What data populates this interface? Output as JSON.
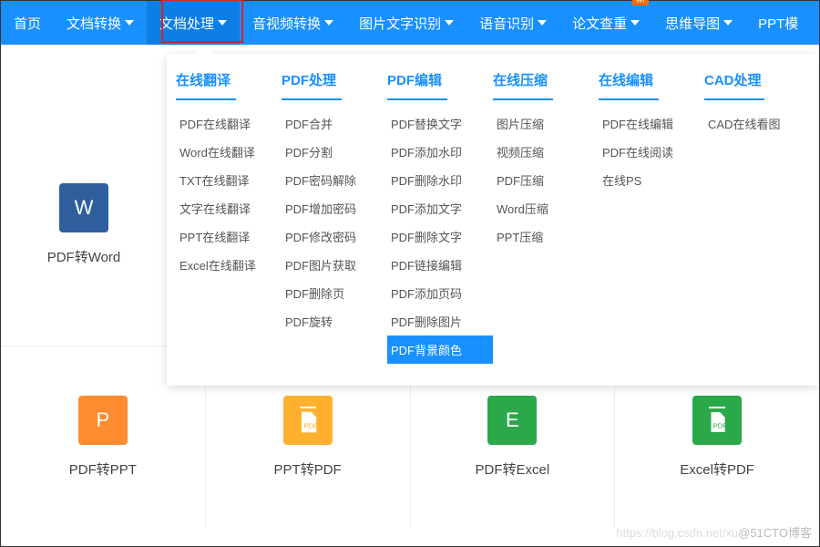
{
  "nav": {
    "items": [
      {
        "label": "首页",
        "caret": false
      },
      {
        "label": "文档转换",
        "caret": true
      },
      {
        "label": "文档处理",
        "caret": true
      },
      {
        "label": "音视频转换",
        "caret": true
      },
      {
        "label": "图片文字识别",
        "caret": true
      },
      {
        "label": "语音识别",
        "caret": true
      },
      {
        "label": "论文查重",
        "caret": true,
        "badge": "新"
      },
      {
        "label": "思维导图",
        "caret": true
      },
      {
        "label": "PPT模",
        "caret": false
      }
    ],
    "activeIndex": 2
  },
  "mega": {
    "columns": [
      {
        "header": "在线翻译",
        "items": [
          "PDF在线翻译",
          "Word在线翻译",
          "TXT在线翻译",
          "文字在线翻译",
          "PPT在线翻译",
          "Excel在线翻译"
        ]
      },
      {
        "header": "PDF处理",
        "items": [
          "PDF合并",
          "PDF分割",
          "PDF密码解除",
          "PDF增加密码",
          "PDF修改密码",
          "PDF图片获取",
          "PDF删除页",
          "PDF旋转"
        ]
      },
      {
        "header": "PDF编辑",
        "items": [
          "PDF替换文字",
          "PDF添加水印",
          "PDF删除水印",
          "PDF添加文字",
          "PDF删除文字",
          "PDF链接编辑",
          "PDF添加页码",
          "PDF删除图片",
          "PDF背景颜色"
        ],
        "highlightHeader": true,
        "selectedIndex": 8
      },
      {
        "header": "在线压缩",
        "items": [
          "图片压缩",
          "视频压缩",
          "PDF压缩",
          "Word压缩",
          "PPT压缩"
        ]
      },
      {
        "header": "在线编辑",
        "items": [
          "PDF在线编辑",
          "PDF在线阅读",
          "在线PS"
        ]
      },
      {
        "header": "CAD处理",
        "items": [
          "CAD在线看图"
        ]
      }
    ]
  },
  "tileW": {
    "label": "PDF转Word",
    "icon": "W"
  },
  "tileRow": [
    {
      "label": "PDF转PPT",
      "icon": "P",
      "cls": "p-icon"
    },
    {
      "label": "PPT转PDF",
      "icon": "PDF",
      "cls": "pdf-icon"
    },
    {
      "label": "PDF转Excel",
      "icon": "E",
      "cls": "e-icon"
    },
    {
      "label": "Excel转PDF",
      "icon": "PDF",
      "cls": "epdf-icon"
    }
  ],
  "watermark": {
    "faint": "https://blog.csdn.net/xu",
    "label": "@51CTO博客"
  },
  "highlight": {
    "navItem": "文档处理",
    "megaColumn": "PDF编辑",
    "selectedItem": "PDF背景颜色"
  }
}
